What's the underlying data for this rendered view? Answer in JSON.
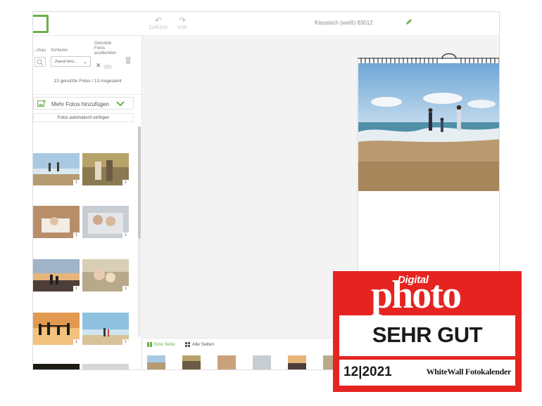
{
  "toolbar": {
    "undo_label": "ZURÜCK",
    "redo_label": "VOR",
    "document_title": "Klassisch (weiß) 83012"
  },
  "left_panel": {
    "preview_label": "...chau",
    "sort_label": "Sortieren",
    "sort_value": "Zuerst hinz...",
    "hide_used_label": "Genutzte Fotos ausblenden",
    "photo_count": "13 genutzte Fotos / 13 insgesamt",
    "add_photos_label": "Mehr Fotos hinzufügen",
    "auto_insert_label": "Fotos automatisch einfügen",
    "thumbnails": [
      {
        "name": "beach-walk",
        "count": "1"
      },
      {
        "name": "couple-forest",
        "count": "1"
      },
      {
        "name": "baby-crib",
        "count": "1"
      },
      {
        "name": "kids-bed",
        "count": "1"
      },
      {
        "name": "sunset-couple",
        "count": "1"
      },
      {
        "name": "mother-child",
        "count": "1"
      },
      {
        "name": "family-silhouette",
        "count": "1"
      },
      {
        "name": "beach-kids",
        "count": "1"
      },
      {
        "name": "dark-photo",
        "count": ""
      },
      {
        "name": "bw-photo",
        "count": ""
      }
    ]
  },
  "bottom_bar": {
    "single_page_label": "Eine Seite",
    "all_pages_label": "Alle Seiten"
  },
  "award": {
    "digital": "Digital",
    "brand": "photo",
    "rating": "SEHR GUT",
    "issue": "12|2021",
    "product": "WhiteWall Fotokalender"
  },
  "colors": {
    "accent_green": "#6ab04c",
    "award_red": "#e52421"
  }
}
